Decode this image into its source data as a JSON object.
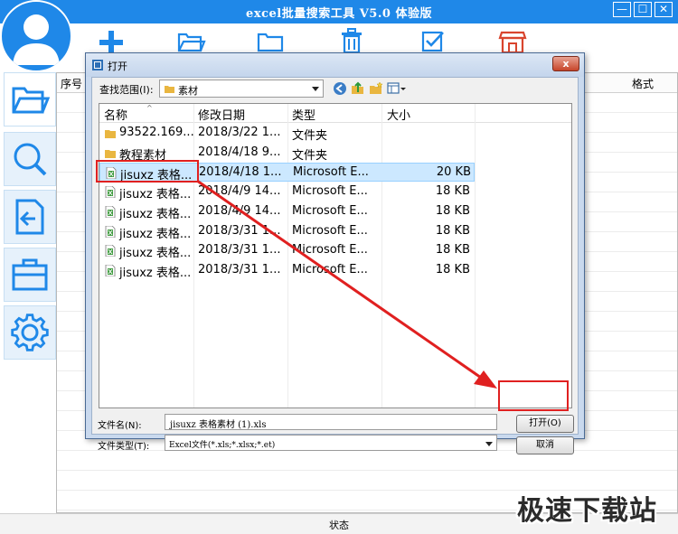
{
  "app": {
    "title": "excel批量搜索工具 V5.0 体验版",
    "window_buttons": {
      "minimize": "—",
      "maximize": "☐",
      "close": "✕"
    },
    "table_header": {
      "seq": "序号",
      "format": "格式"
    },
    "status": "状态",
    "watermark": "极速下载站",
    "brand_color": "#1f88e8"
  },
  "toolbar": {
    "icons": [
      "plus-icon",
      "open-folder-icon",
      "folder-icon",
      "trash-icon",
      "checkbox-icon",
      "store-icon"
    ]
  },
  "sidebar": {
    "items": [
      "open-folder-icon",
      "search-icon",
      "export-icon",
      "toolbox-icon",
      "gear-icon"
    ]
  },
  "dialog": {
    "title": "打开",
    "close_label": "x",
    "lookin_label": "查找范围(I):",
    "lookin_value": "素材",
    "columns": {
      "name": "名称",
      "date": "修改日期",
      "type": "类型",
      "size": "大小"
    },
    "files": [
      {
        "name": "93522.169...",
        "date": "2018/3/22 1...",
        "type": "文件夹",
        "size": "",
        "icon": "folder"
      },
      {
        "name": "教程素材",
        "date": "2018/4/18 9...",
        "type": "文件夹",
        "size": "",
        "icon": "folder"
      },
      {
        "name": "jisuxz 表格...",
        "date": "2018/4/18 1...",
        "type": "Microsoft E...",
        "size": "20 KB",
        "icon": "excel"
      },
      {
        "name": "jisuxz 表格...",
        "date": "2018/4/9 14...",
        "type": "Microsoft E...",
        "size": "18 KB",
        "icon": "excel"
      },
      {
        "name": "jisuxz 表格...",
        "date": "2018/4/9 14...",
        "type": "Microsoft E...",
        "size": "18 KB",
        "icon": "excel"
      },
      {
        "name": "jisuxz 表格...",
        "date": "2018/3/31 1...",
        "type": "Microsoft E...",
        "size": "18 KB",
        "icon": "excel"
      },
      {
        "name": "jisuxz 表格...",
        "date": "2018/3/31 1...",
        "type": "Microsoft E...",
        "size": "18 KB",
        "icon": "excel"
      },
      {
        "name": "jisuxz 表格...",
        "date": "2018/3/31 1...",
        "type": "Microsoft E...",
        "size": "18 KB",
        "icon": "excel"
      }
    ],
    "selected_index": 2,
    "filename_label": "文件名(N):",
    "filename_value": "jisuxz 表格素材 (1).xls",
    "filetype_label": "文件类型(T):",
    "filetype_value": "Excel文件(*.xls;*.xlsx;*.et)",
    "open_button": "打开(O)",
    "cancel_button": "取消"
  },
  "annotation_color": "#e02020"
}
